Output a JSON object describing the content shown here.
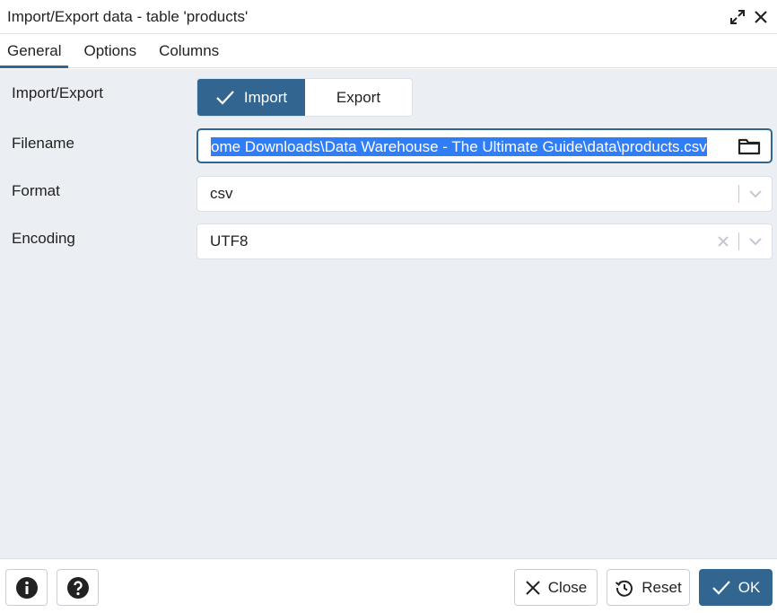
{
  "window": {
    "title": "Import/Export data - table 'products'"
  },
  "tabs": [
    {
      "label": "General",
      "active": true
    },
    {
      "label": "Options",
      "active": false
    },
    {
      "label": "Columns",
      "active": false
    }
  ],
  "form": {
    "import_export": {
      "label": "Import/Export",
      "options": [
        "Import",
        "Export"
      ],
      "selected": "Import"
    },
    "filename": {
      "label": "Filename",
      "value": "ome Downloads\\Data Warehouse - The Ultimate Guide\\data\\products.csv"
    },
    "format": {
      "label": "Format",
      "value": "csv"
    },
    "encoding": {
      "label": "Encoding",
      "value": "UTF8"
    }
  },
  "footer": {
    "close_label": "Close",
    "reset_label": "Reset",
    "ok_label": "OK"
  },
  "icons": {
    "expand": "expand-icon",
    "info": "info-icon",
    "help": "help-icon",
    "folder": "folder-icon",
    "check": "check-icon",
    "close": "close-icon",
    "reset": "reset-icon",
    "chevron": "chevron-down-icon"
  },
  "colors": {
    "primary": "#326690",
    "selection": "#2f7ef7",
    "background": "#ebeef3"
  }
}
